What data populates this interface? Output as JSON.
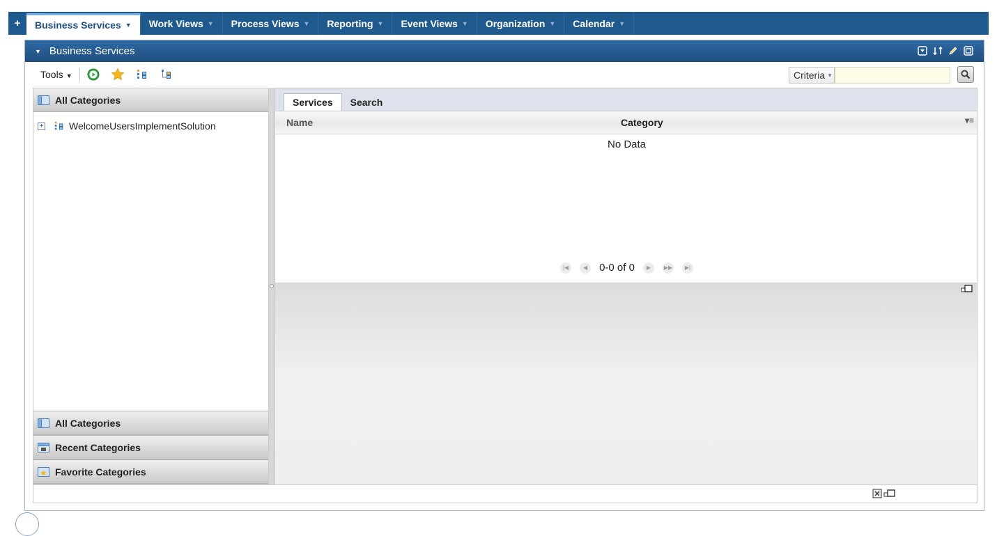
{
  "nav": {
    "plus": "+",
    "tabs": [
      {
        "label": "Business Services"
      },
      {
        "label": "Work Views"
      },
      {
        "label": "Process Views"
      },
      {
        "label": "Reporting"
      },
      {
        "label": "Event Views"
      },
      {
        "label": "Organization"
      },
      {
        "label": "Calendar"
      }
    ]
  },
  "panel": {
    "title": "Business Services"
  },
  "toolbar": {
    "tools_label": "Tools",
    "criteria_label": "Criteria",
    "criteria_value": ""
  },
  "left": {
    "header": "All Categories",
    "tree": [
      {
        "label": "WelcomeUsersImplementSolution"
      }
    ],
    "bottom_headers": [
      {
        "label": "All Categories"
      },
      {
        "label": "Recent Categories"
      },
      {
        "label": "Favorite Categories"
      }
    ]
  },
  "right": {
    "tabs": [
      {
        "label": "Services"
      },
      {
        "label": "Search"
      }
    ],
    "columns": {
      "name": "Name",
      "category": "Category"
    },
    "empty_text": "No Data",
    "pager_text": "0-0 of 0"
  },
  "colors": {
    "nav_bg": "#1f5a8e",
    "title_bg": "#2f6aa3",
    "accent": "#1f4f86"
  }
}
